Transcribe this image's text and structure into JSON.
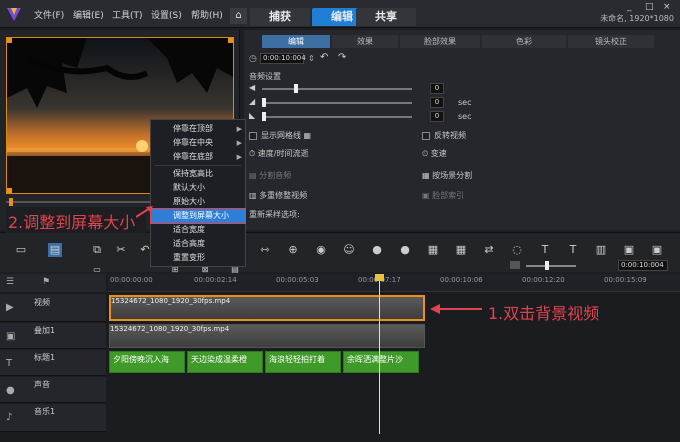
{
  "title_bar": {
    "menus": [
      "文件(F)",
      "编辑(E)",
      "工具(T)",
      "设置(S)",
      "帮助(H)"
    ],
    "tabs": [
      "捕获",
      "编辑",
      "共享"
    ],
    "active_tab": "编辑",
    "project_info": "未命名, 1920*1080",
    "window_controls": [
      "_",
      "□",
      "×"
    ]
  },
  "preview": {
    "project_label": "项目",
    "clip_label": "素材"
  },
  "options": {
    "tabs": [
      "编辑",
      "效果",
      "脸部效果",
      "色彩",
      "镜头校正"
    ],
    "active_tab": "编辑",
    "duration": "0:00:10:004",
    "audio_settings_label": "音频设置",
    "sec_label": "sec",
    "num_values": [
      "0",
      "0",
      "0"
    ],
    "rows_left": [
      "显示网格线",
      "速度/时间流逝",
      "分割音频",
      "多重修整视频"
    ],
    "rows_right": [
      "反转视频",
      "变速",
      "按场景分割",
      "脸部索引"
    ],
    "resample_label": "重新采样选项:"
  },
  "context_menu": {
    "items": [
      "停靠在顶部",
      "停靠在中央",
      "停靠在底部",
      "保持宽高比",
      "默认大小",
      "原始大小",
      "调整到屏幕大小",
      "适合宽度",
      "适合高度",
      "重置变形"
    ],
    "highlighted": "调整到屏幕大小"
  },
  "annotations": {
    "step1": "1.双击背景视频",
    "step2": "2.调整到屏幕大小"
  },
  "timeline": {
    "timecode": "0:00:10:004",
    "ruler": [
      "00:00:00:00",
      "00:00:02:14",
      "00:00:05:03",
      "00:00:07:17",
      "00:00:10:06",
      "00:00:12:20",
      "00:00:15:09"
    ],
    "tracks": [
      "视频",
      "叠加1",
      "标题1",
      "声音",
      "音乐1"
    ],
    "video_clip": "15324672_1080_1920_30fps.mp4",
    "overlay_clip": "15324672_1080_1920_30fps.mp4",
    "title_clips": [
      "夕阳傍晚沉入海",
      "天边染成温柔橙",
      "海浪轻轻拍打着",
      "余晖洒满整片沙"
    ]
  },
  "colors": {
    "accent": "#1f7fd6",
    "annotation": "#e0434d",
    "title_clip": "#3f9a2a",
    "selection": "#d88a18"
  }
}
